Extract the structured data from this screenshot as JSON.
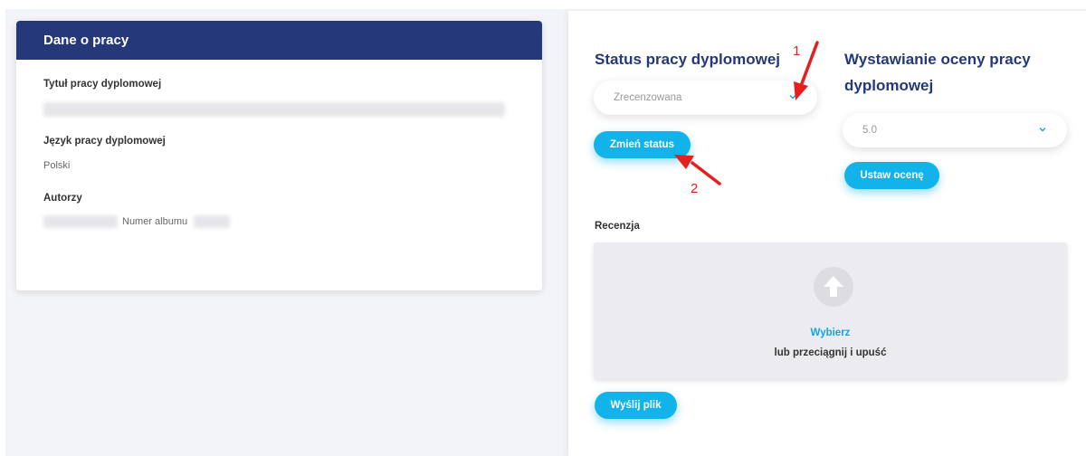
{
  "left_card": {
    "header": "Dane o pracy",
    "title_label": "Tytuł pracy dyplomowej",
    "language_label": "Język pracy dyplomowej",
    "language_value": "Polski",
    "authors_label": "Autorzy",
    "album_label": "Numer albumu"
  },
  "status": {
    "title": "Status pracy dyplomowej",
    "selected": "Zrecenzowana",
    "button": "Zmień status"
  },
  "grade": {
    "title_line1": "Wystawianie oceny pracy",
    "title_line2": "dyplomowej",
    "selected": "5.0",
    "button": "Ustaw ocenę"
  },
  "review": {
    "label": "Recenzja",
    "choose_link": "Wybierz",
    "drag_text": "lub przeciągnij i upuść",
    "send_button": "Wyślij plik"
  },
  "annotations": {
    "marker_1": "1",
    "marker_2": "2"
  },
  "colors": {
    "header_bg": "#24387a",
    "accent": "#12b2ea",
    "annotation": "#e51e1e"
  }
}
